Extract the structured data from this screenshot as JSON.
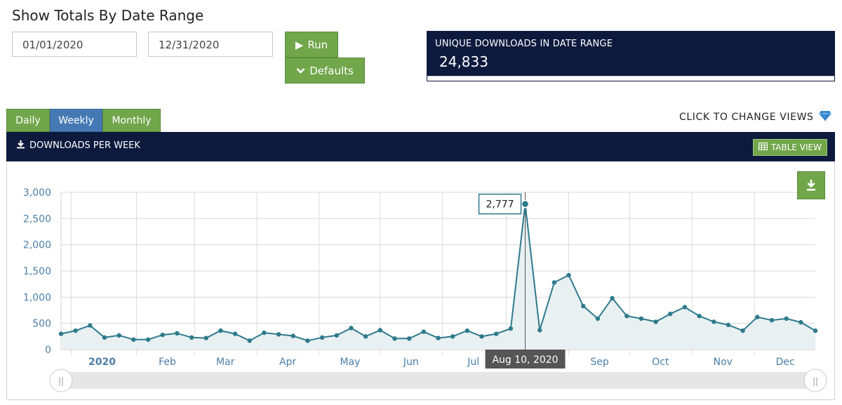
{
  "header": {
    "title": "Show Totals By Date Range"
  },
  "date_range": {
    "start": "01/01/2020",
    "end": "12/31/2020"
  },
  "buttons": {
    "run": "Run",
    "defaults": "Defaults",
    "table_view": "TABLE VIEW"
  },
  "summary": {
    "label": "UNIQUE DOWNLOADS IN DATE RANGE",
    "value": "24,833"
  },
  "tabs": [
    {
      "label": "Daily",
      "active": false
    },
    {
      "label": "Weekly",
      "active": true
    },
    {
      "label": "Monthly",
      "active": false
    }
  ],
  "hint": "CLICK TO CHANGE VIEWS",
  "panel": {
    "title": "DOWNLOADS PER WEEK"
  },
  "tooltip": {
    "value": "2,777",
    "date": "Aug 10, 2020"
  },
  "colors": {
    "navy": "#0d1a3d",
    "green": "#71a64b",
    "blue": "#4479b4",
    "line": "#2e7a8c",
    "fill": "#e8f0f2"
  },
  "chart_data": {
    "type": "area",
    "title": "",
    "xlabel": "",
    "ylabel": "",
    "ylim": [
      0,
      3000
    ],
    "y_ticks": [
      "0",
      "500",
      "1,000",
      "1,500",
      "2,000",
      "2,500",
      "3,000"
    ],
    "x_tick_labels": [
      "2020",
      "Feb",
      "Mar",
      "Apr",
      "May",
      "Jun",
      "Jul",
      "Aug",
      "Sep",
      "Oct",
      "Nov",
      "Dec"
    ],
    "grid": true,
    "series": [
      {
        "values": [
          300,
          360,
          460,
          230,
          270,
          190,
          190,
          280,
          310,
          230,
          220,
          360,
          300,
          170,
          320,
          290,
          260,
          170,
          230,
          270,
          410,
          250,
          370,
          210,
          210,
          340,
          220,
          250,
          360,
          250,
          300,
          400,
          2777,
          370,
          1280,
          1420,
          830,
          590,
          980,
          640,
          590,
          530,
          680,
          810,
          640,
          530,
          470,
          360,
          620,
          560,
          590,
          520,
          360
        ]
      }
    ],
    "highlight": {
      "index": 32,
      "value": 2777,
      "date": "Aug 10, 2020"
    }
  }
}
